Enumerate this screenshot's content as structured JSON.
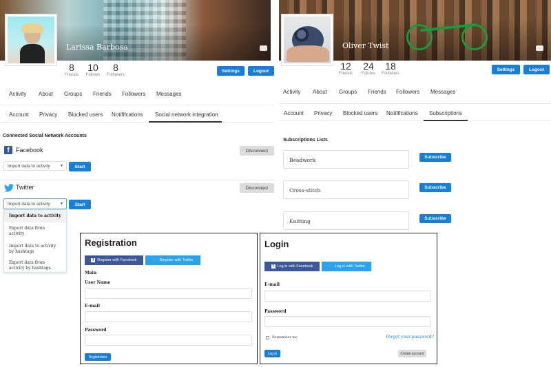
{
  "left_profile": {
    "name": "Larissa Barbosa",
    "stats": [
      {
        "value": "8",
        "label": "Friends"
      },
      {
        "value": "10",
        "label": "Follows"
      },
      {
        "value": "8",
        "label": "Followers"
      }
    ],
    "settings_label": "Settings",
    "logout_label": "Logout",
    "nav": [
      "Activity",
      "About",
      "Groups",
      "Friends",
      "Followers",
      "Messages"
    ],
    "subnav": [
      "Account",
      "Privacy",
      "Blocked users",
      "Notififcations",
      "Social network integration"
    ],
    "section_title": "Connected Social Network Accounts",
    "facebook": {
      "name": "Facebook",
      "disconnect": "Disconnect",
      "select": "Import data to activity",
      "start": "Start"
    },
    "twitter": {
      "name": "Twitter",
      "disconnect": "Disconnect",
      "select": "Import data to activity",
      "start": "Start"
    },
    "dropdown_options": [
      "Import data to activity",
      "Export data from activity",
      "Import data to activity by hashtags",
      "Export data from activity by hashtags"
    ]
  },
  "right_profile": {
    "name": "Oliver Twist",
    "stats": [
      {
        "value": "12",
        "label": "Friends"
      },
      {
        "value": "24",
        "label": "Follows"
      },
      {
        "value": "18",
        "label": "Followers"
      }
    ],
    "settings_label": "Settings",
    "logout_label": "Logout",
    "nav": [
      "Activity",
      "About",
      "Groups",
      "Friends",
      "Followers",
      "Messages"
    ],
    "subnav": [
      "Account",
      "Privacy",
      "Blocked users",
      "Notififcations",
      "Subscriptions"
    ],
    "section_title": "Subscriptions Lists",
    "subscriptions": [
      {
        "name": "Beadwork",
        "button": "Subscribe"
      },
      {
        "name": "Cross-stitch",
        "button": "Subscribe"
      },
      {
        "name": "Knitting",
        "button": "Subscribe"
      }
    ]
  },
  "registration": {
    "title": "Registration",
    "fb_button": "Register with Facebook",
    "tw_button": "Register with Twitter",
    "section": "Main",
    "username_label": "User Name",
    "email_label": "E-mail",
    "password_label": "Password",
    "submit": "Registration"
  },
  "login": {
    "title": "Login",
    "fb_button": "Log in with Facebook",
    "tw_button": "Log in with Twitter",
    "email_label": "E-mail",
    "password_label": "Password",
    "remember": "Remember me",
    "forgot": "Forgot your password?",
    "submit": "Log in",
    "create": "Create account"
  },
  "colors": {
    "accent": "#1a7fd4",
    "facebook": "#3b5998",
    "twitter": "#2aa3ef"
  }
}
